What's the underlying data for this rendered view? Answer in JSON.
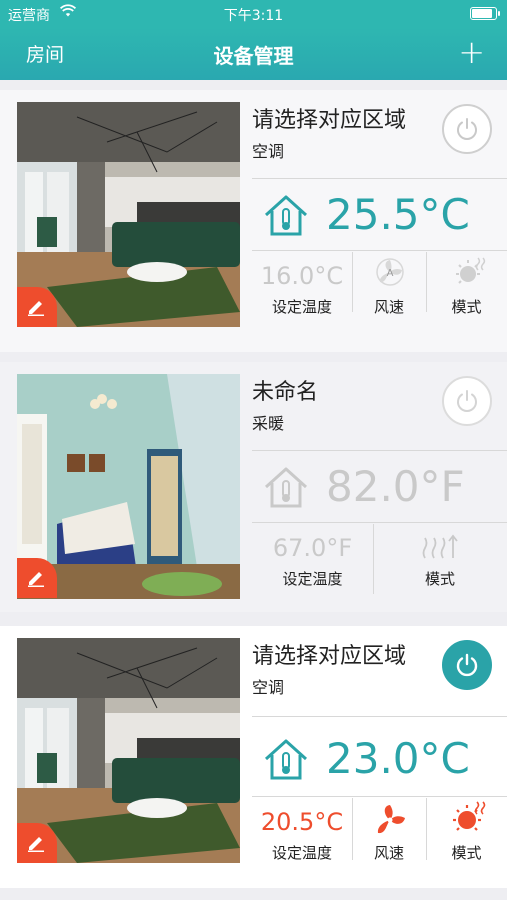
{
  "status": {
    "carrier": "运营商",
    "time": "下午3:11"
  },
  "nav": {
    "left": "房间",
    "title": "设备管理",
    "add": "+"
  },
  "devices": [
    {
      "name": "请选择对应区域",
      "type": "空调",
      "power_on": false,
      "current_temp": "25.5°C",
      "set_temp": "16.0°C",
      "set_temp_label": "设定温度",
      "fan_label": "风速",
      "mode_label": "模式"
    },
    {
      "name": "未命名",
      "type": "采暖",
      "power_on": false,
      "current_temp": "82.0°F",
      "set_temp": "67.0°F",
      "set_temp_label": "设定温度",
      "mode_label": "模式"
    },
    {
      "name": "请选择对应区域",
      "type": "空调",
      "power_on": true,
      "current_temp": "23.0°C",
      "set_temp": "20.5°C",
      "set_temp_label": "设定温度",
      "fan_label": "风速",
      "mode_label": "模式"
    }
  ],
  "colors": {
    "teal": "#2aa3a8",
    "orange": "#ee4d2d",
    "off": "#c9c9c9"
  }
}
